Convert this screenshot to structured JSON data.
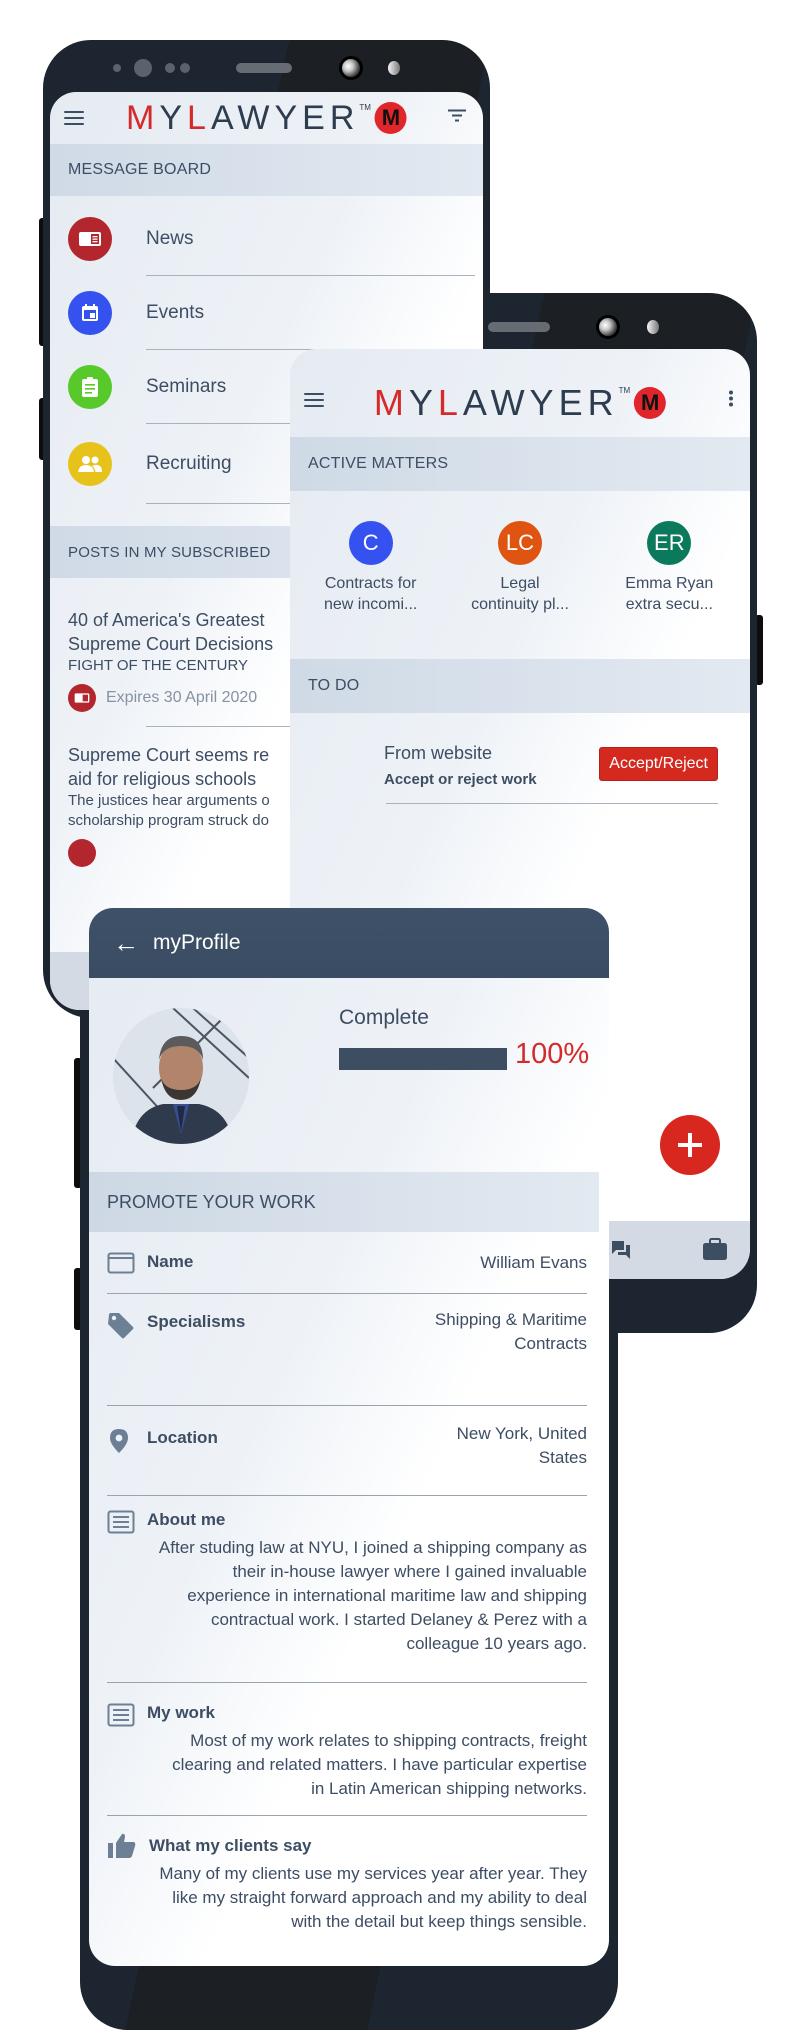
{
  "brand": {
    "logo_prefix_m": "M",
    "logo_prefix_y": "Y",
    "logo_l": "L",
    "logo_rest": "AWYER",
    "logo_tm": "TM",
    "logo_badge": "M",
    "colors": {
      "accent_red": "#d52a2a",
      "navy": "#3d4d63",
      "header_bar": "#3e5168"
    }
  },
  "message_board_screen": {
    "section_title": "MESSAGE BOARD",
    "menu_icon": "hamburger-icon",
    "filter_icon": "filter-icon",
    "items": [
      {
        "label": "News",
        "icon": "newspaper-icon",
        "color": "#b3262d"
      },
      {
        "label": "Events",
        "icon": "calendar-icon",
        "color": "#3551f0"
      },
      {
        "label": "Seminars",
        "icon": "clipboard-icon",
        "color": "#58c92a"
      },
      {
        "label": "Recruiting",
        "icon": "people-icon",
        "color": "#e6c21a"
      }
    ],
    "posts_section_title": "POSTS IN MY SUBSCRIBED",
    "posts": [
      {
        "title_line1": "40 of America's Greatest",
        "title_line2": "Supreme Court Decisions",
        "subtitle": "FIGHT OF THE CENTURY",
        "expiry": "Expires 30 April 2020"
      },
      {
        "title_line1": "Supreme Court seems re",
        "title_line2": "aid for religious schools",
        "body_line1": "The justices hear arguments o",
        "body_line2": "scholarship program struck do"
      }
    ]
  },
  "matters_screen": {
    "more_icon": "more-vertical-icon",
    "active_matters_title": "ACTIVE MATTERS",
    "matters": [
      {
        "initials": "C",
        "line1": "Contracts for",
        "line2": "new incomi...",
        "color": "#3551f0"
      },
      {
        "initials": "LC",
        "line1": "Legal",
        "line2": "continuity pl...",
        "color": "#de5410"
      },
      {
        "initials": "ER",
        "line1": "Emma Ryan",
        "line2": "extra secu...",
        "color": "#0b7a5c"
      }
    ],
    "todo_title": "TO DO",
    "todo": {
      "title": "From website",
      "subtitle": "Accept or reject work",
      "button": "Accept/Reject"
    },
    "fab": "+",
    "nav_icons": [
      "chat-icon",
      "briefcase-icon"
    ]
  },
  "profile_screen": {
    "title": "myProfile",
    "back": "←",
    "complete_label": "Complete",
    "progress_percent": 100,
    "progress_text": "100%",
    "promote_title": "PROMOTE YOUR WORK",
    "fields": [
      {
        "label": "Name",
        "value": "William Evans",
        "icon": "id-card-icon"
      },
      {
        "label": "Specialisms",
        "value_line1": "Shipping & Maritime",
        "value_line2": "Contracts",
        "icon": "tag-icon"
      },
      {
        "label": "Location",
        "value_line1": "New York, United",
        "value_line2": "States",
        "icon": "location-pin-icon"
      }
    ],
    "about": {
      "title": "About me",
      "lines": [
        "After studing law at NYU, I joined a shipping company as",
        "their in-house lawyer where I gained invaluable",
        "experience in international maritime law and shipping",
        "contractual work.  I started Delaney & Perez with a",
        "colleague 10 years ago."
      ]
    },
    "my_work": {
      "title": "My work",
      "lines": [
        "Most of my work relates to shipping contracts, freight",
        "clearing and related matters.  I have particular expertise",
        "in Latin American shipping networks."
      ]
    },
    "clients": {
      "title": "What my clients say",
      "lines": [
        "Many of my clients use my services year after year.  They",
        "like my straight forward approach and my ability to deal",
        "with the detail but keep things sensible."
      ]
    }
  }
}
